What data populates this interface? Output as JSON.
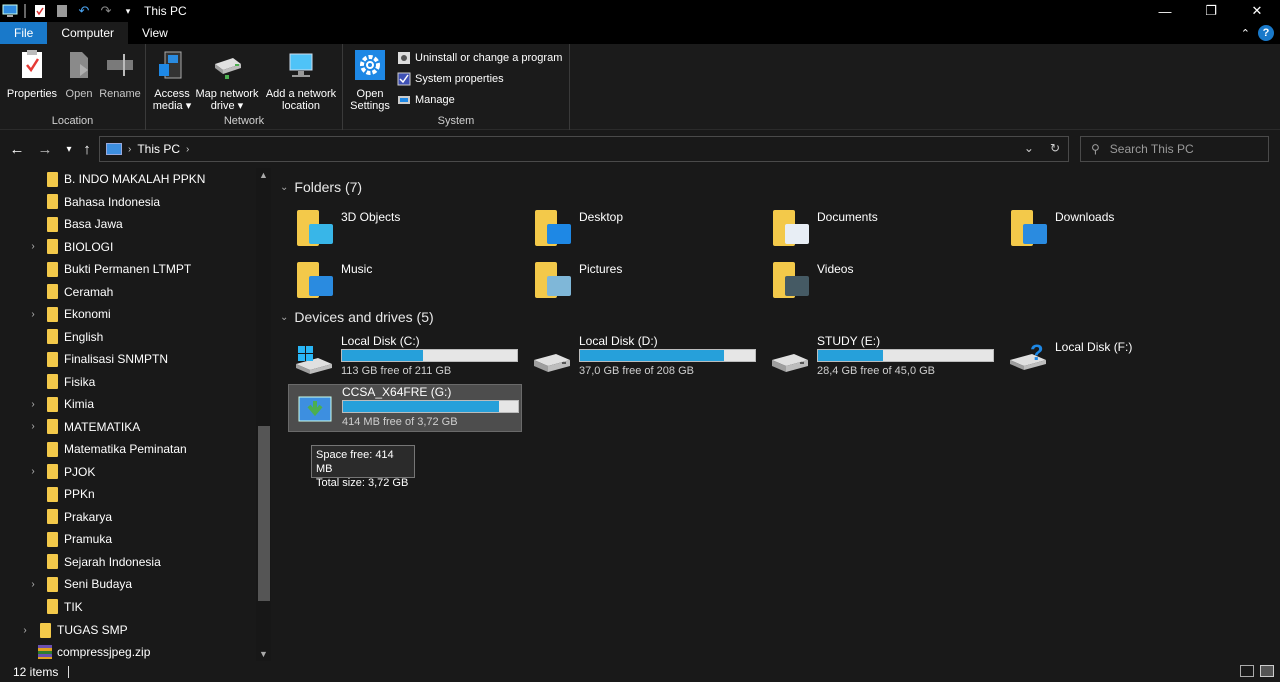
{
  "window": {
    "title": "This PC"
  },
  "tabs": {
    "file": "File",
    "computer": "Computer",
    "view": "View"
  },
  "ribbon": {
    "location": {
      "label": "Location",
      "properties": "Properties",
      "open": "Open",
      "rename": "Rename"
    },
    "network": {
      "label": "Network",
      "access_media_1": "Access",
      "access_media_2": "media",
      "map_drive_1": "Map network",
      "map_drive_2": "drive",
      "add_location_1": "Add a network",
      "add_location_2": "location"
    },
    "system": {
      "label": "System",
      "open_settings_1": "Open",
      "open_settings_2": "Settings",
      "uninstall": "Uninstall or change a program",
      "system_properties": "System properties",
      "manage": "Manage"
    }
  },
  "address": {
    "crumb": "This PC",
    "search_placeholder": "Search This PC"
  },
  "sidebar": {
    "items": [
      {
        "label": "B. INDO MAKALAH PPKN",
        "expandable": false
      },
      {
        "label": "Bahasa Indonesia",
        "expandable": false
      },
      {
        "label": "Basa Jawa",
        "expandable": false
      },
      {
        "label": "BIOLOGI",
        "expandable": true
      },
      {
        "label": "Bukti Permanen LTMPT",
        "expandable": false
      },
      {
        "label": "Ceramah",
        "expandable": false
      },
      {
        "label": "Ekonomi",
        "expandable": true
      },
      {
        "label": "English",
        "expandable": false
      },
      {
        "label": "Finalisasi SNMPTN",
        "expandable": false
      },
      {
        "label": "Fisika",
        "expandable": false
      },
      {
        "label": "Kimia",
        "expandable": true
      },
      {
        "label": "MATEMATIKA",
        "expandable": true
      },
      {
        "label": "Matematika Peminatan",
        "expandable": false
      },
      {
        "label": "PJOK",
        "expandable": true
      },
      {
        "label": "PPKn",
        "expandable": false
      },
      {
        "label": "Prakarya",
        "expandable": false
      },
      {
        "label": "Pramuka",
        "expandable": false
      },
      {
        "label": "Sejarah Indonesia",
        "expandable": false
      },
      {
        "label": "Seni Budaya",
        "expandable": true
      },
      {
        "label": "TIK",
        "expandable": false
      }
    ],
    "tugas_smp": "TUGAS SMP",
    "compress": "compressjpeg.zip"
  },
  "folders": {
    "heading": "Folders (7)",
    "items": [
      {
        "label": "3D Objects",
        "overlay": "#38b6e8"
      },
      {
        "label": "Desktop",
        "overlay": "#1e88e5"
      },
      {
        "label": "Documents",
        "overlay": "#e8eef5"
      },
      {
        "label": "Downloads",
        "overlay": "#2a8be0"
      },
      {
        "label": "Music",
        "overlay": "#2a8be0"
      },
      {
        "label": "Pictures",
        "overlay": "#7fb7d8"
      },
      {
        "label": "Videos",
        "overlay": "#455a64"
      }
    ]
  },
  "drives": {
    "heading": "Devices and drives (5)",
    "items": [
      {
        "name": "Local Disk (C:)",
        "free": "113 GB free of 211 GB",
        "used_fraction": 0.46
      },
      {
        "name": "Local Disk (D:)",
        "free": "37,0 GB free of 208 GB",
        "used_fraction": 0.82
      },
      {
        "name": "STUDY (E:)",
        "free": "28,4 GB free of 45,0 GB",
        "used_fraction": 0.37
      },
      {
        "name": "Local Disk (F:)"
      },
      {
        "name": "CCSA_X64FRE (G:)",
        "free": "414 MB free of 3,72 GB",
        "used_fraction": 0.89
      }
    ]
  },
  "tooltip": {
    "line1": "Space free: 414 MB",
    "line2": "Total size: 3,72 GB"
  },
  "status": {
    "count": "12 items"
  }
}
